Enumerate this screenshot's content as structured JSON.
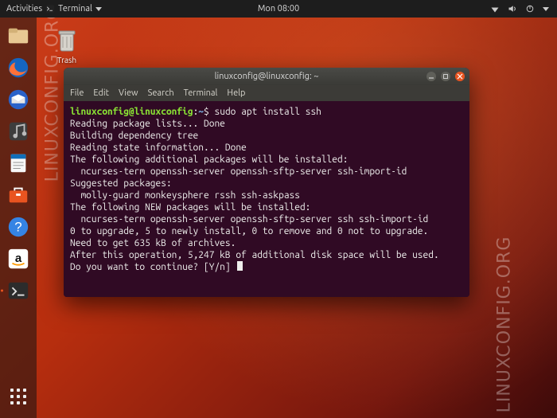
{
  "topbar": {
    "activities": "Activities",
    "app_name": "Terminal",
    "clock": "Mon 08:00"
  },
  "desktop": {
    "trash_label": "Trash"
  },
  "watermark": "LINUXCONFIG.ORG",
  "dock": {
    "items": [
      {
        "name": "nautilus-files"
      },
      {
        "name": "firefox"
      },
      {
        "name": "thunderbird"
      },
      {
        "name": "rhythmbox"
      },
      {
        "name": "libreoffice-writer"
      },
      {
        "name": "ubuntu-software"
      },
      {
        "name": "gnome-help"
      },
      {
        "name": "amazon"
      },
      {
        "name": "gnome-terminal"
      }
    ]
  },
  "terminal": {
    "title": "linuxconfig@linuxconfig: ~",
    "menus": [
      "File",
      "Edit",
      "View",
      "Search",
      "Terminal",
      "Help"
    ],
    "prompt": {
      "userhost": "linuxconfig@linuxconfig",
      "sep1": ":",
      "path": "~",
      "sep2": "$"
    },
    "command": "sudo apt install ssh",
    "output": [
      "Reading package lists... Done",
      "Building dependency tree",
      "Reading state information... Done",
      "The following additional packages will be installed:",
      "  ncurses-term openssh-server openssh-sftp-server ssh-import-id",
      "Suggested packages:",
      "  molly-guard monkeysphere rssh ssh-askpass",
      "The following NEW packages will be installed:",
      "  ncurses-term openssh-server openssh-sftp-server ssh ssh-import-id",
      "0 to upgrade, 5 to newly install, 0 to remove and 0 not to upgrade.",
      "Need to get 635 kB of archives.",
      "After this operation, 5,247 kB of additional disk space will be used.",
      "Do you want to continue? [Y/n] "
    ]
  }
}
